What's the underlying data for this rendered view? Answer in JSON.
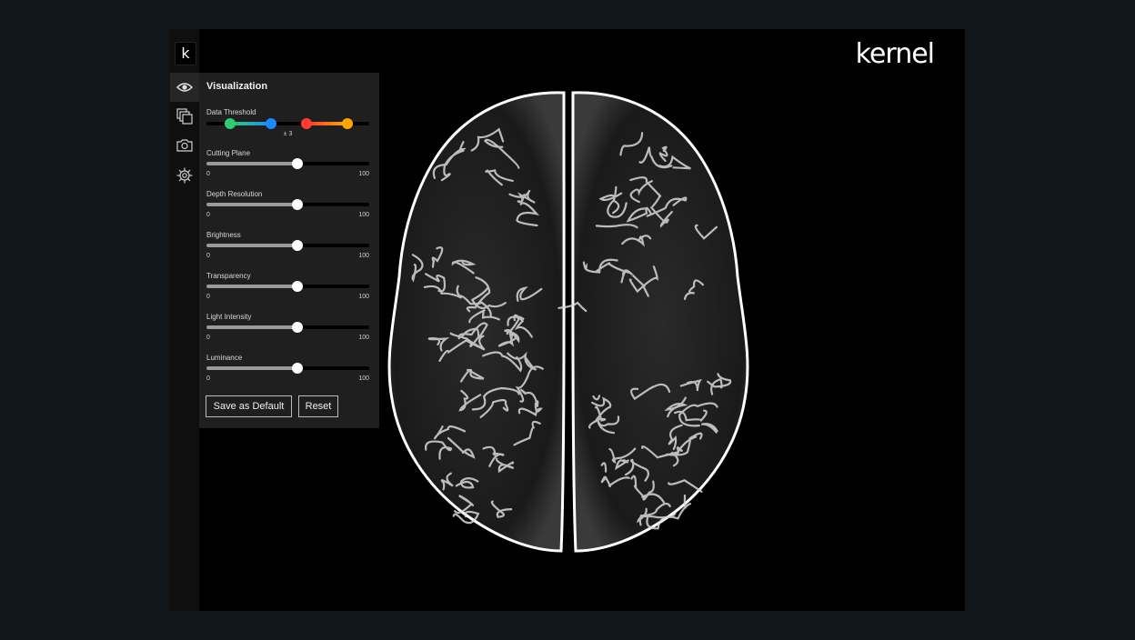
{
  "brand": {
    "logo_text": "kernel",
    "rail_logo_glyph": "k"
  },
  "rail": {
    "items": [
      {
        "icon": "eye-icon",
        "active": true
      },
      {
        "icon": "layers-icon",
        "active": false
      },
      {
        "icon": "camera-icon",
        "active": false
      },
      {
        "icon": "gear-icon",
        "active": false
      }
    ]
  },
  "panel": {
    "title": "Visualization",
    "threshold": {
      "label": "Data Threshold",
      "center_text": "± 3",
      "colors": {
        "low_start": "#2ecc71",
        "low_end": "#1e88ff",
        "high_start": "#ff3b30",
        "high_end": "#ffa500"
      }
    },
    "sliders": [
      {
        "label": "Cutting Plane",
        "min": "0",
        "max": "100",
        "value": 56
      },
      {
        "label": "Depth Resolution",
        "min": "0",
        "max": "100",
        "value": 56
      },
      {
        "label": "Brightness",
        "min": "0",
        "max": "100",
        "value": 56
      },
      {
        "label": "Transparency",
        "min": "0",
        "max": "100",
        "value": 56
      },
      {
        "label": "Light Intensity",
        "min": "0",
        "max": "100",
        "value": 56
      },
      {
        "label": "Luminance",
        "min": "0",
        "max": "100",
        "value": 56
      }
    ],
    "buttons": {
      "save": "Save as Default",
      "reset": "Reset"
    }
  }
}
